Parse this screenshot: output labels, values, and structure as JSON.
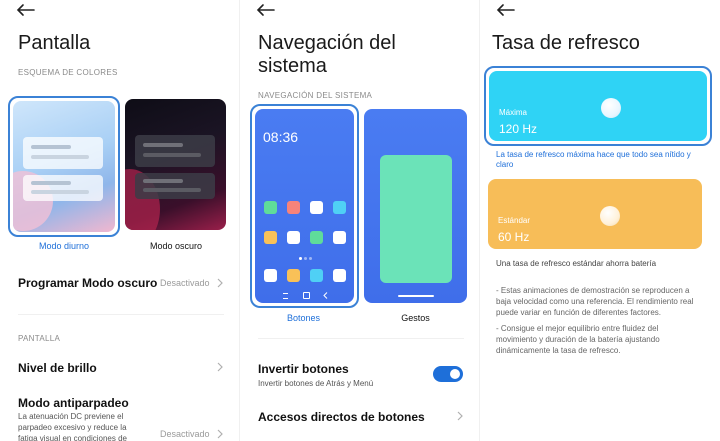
{
  "colors": {
    "accent": "#1e6fd9",
    "frame": "#3b82d6",
    "cyan": "#2fd3f5",
    "orange": "#f7bd58"
  },
  "panel1": {
    "title": "Pantalla",
    "section_scheme": "ESQUEMA DE COLORES",
    "schemes": [
      {
        "label": "Modo diurno"
      },
      {
        "label": "Modo oscuro"
      }
    ],
    "program_dark": {
      "title": "Programar Modo oscuro",
      "value": "Desactivado"
    },
    "section_screen": "PANTALLA",
    "brightness": {
      "title": "Nivel de brillo"
    },
    "antiflicker": {
      "title": "Modo antiparpadeo",
      "desc": [
        "La atenuación DC previene el",
        "parpadeo excesivo y reduce la",
        "fatiga visual en condiciones de"
      ],
      "value": "Desactivado"
    }
  },
  "panel2": {
    "title_line1": "Navegación del",
    "title_line2": "sistema",
    "section": "NAVEGACIÓN DEL SISTEMA",
    "clock": "08:36",
    "options": [
      {
        "label": "Botones"
      },
      {
        "label": "Gestos"
      }
    ],
    "invert": {
      "title": "Invertir botones",
      "desc": "Invertir botones de Atrás y Menú",
      "enabled": true
    },
    "shortcuts": {
      "title": "Accesos directos de botones"
    }
  },
  "panel3": {
    "title": "Tasa de refresco",
    "max": {
      "label": "Máxima",
      "value": "120 Hz",
      "desc": [
        "La tasa de refresco máxima hace que todo sea nítido y",
        "claro"
      ]
    },
    "std": {
      "label": "Estándar",
      "value": "60 Hz",
      "desc": "Una tasa de refresco estándar ahorra batería"
    },
    "note1": [
      "- Estas animaciones de demostración se reproducen a",
      "baja velocidad como una referencia. El rendimiento real",
      "puede variar en función de diferentes factores."
    ],
    "note2": [
      "- Consigue el mejor equilibrio entre fluidez del",
      "movimiento y duración de la batería ajustando",
      "dinámicamente la tasa de refresco."
    ]
  }
}
